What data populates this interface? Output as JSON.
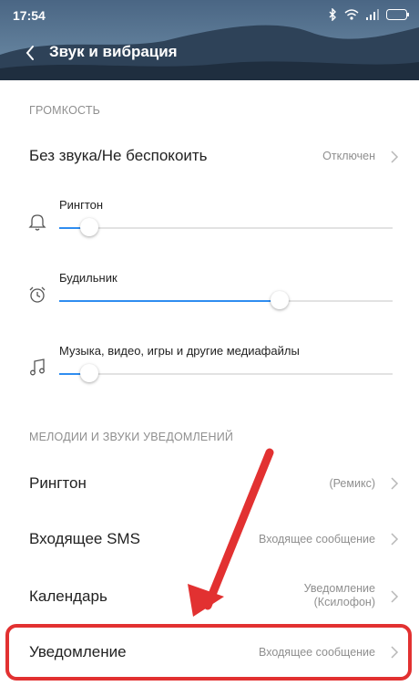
{
  "status_bar": {
    "time": "17:54"
  },
  "header": {
    "title": "Звук и вибрация"
  },
  "volume_section": {
    "heading": "ГРОМКОСТЬ",
    "dnd": {
      "label": "Без звука/Не беспокоить",
      "value": "Отключен"
    },
    "sliders": [
      {
        "label": "Рингтон",
        "level": 0.09,
        "icon": "bell-icon"
      },
      {
        "label": "Будильник",
        "level": 0.66,
        "icon": "alarm-clock-icon"
      },
      {
        "label": "Музыка, видео, игры и другие медиафайлы",
        "level": 0.09,
        "icon": "music-note-icon"
      }
    ]
  },
  "sounds_section": {
    "heading": "МЕЛОДИИ И ЗВУКИ УВЕДОМЛЕНИЙ",
    "items": [
      {
        "label": "Рингтон",
        "value": "(Ремикс)"
      },
      {
        "label": "Входящее SMS",
        "value": "Входящее сообщение"
      },
      {
        "label": "Календарь",
        "value_line1": "Уведомление",
        "value_line2": "(Ксилофон)"
      },
      {
        "label": "Уведомление",
        "value": "Входящее сообщение"
      }
    ]
  },
  "colors": {
    "accent": "#2f8df0",
    "highlight": "#e23131"
  }
}
